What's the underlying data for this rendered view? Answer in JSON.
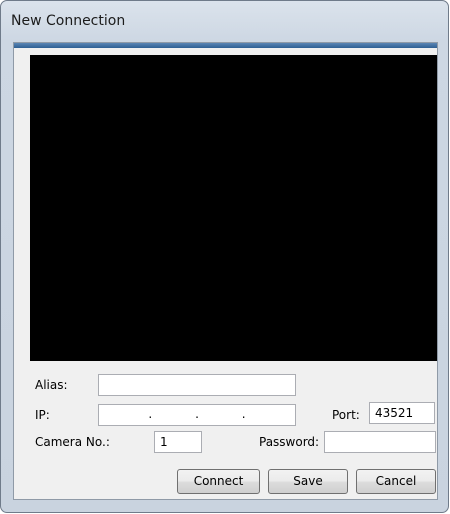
{
  "window": {
    "title": "New Connection"
  },
  "form": {
    "alias_label": "Alias:",
    "alias_value": "",
    "ip_label": "IP:",
    "ip_separators": [
      ".",
      ".",
      "."
    ],
    "port_label": "Port:",
    "port_value": "43521",
    "camera_label": "Camera No.:",
    "camera_value": "1",
    "password_label": "Password:",
    "password_value": ""
  },
  "buttons": {
    "connect": "Connect",
    "save": "Save",
    "cancel": "Cancel"
  }
}
